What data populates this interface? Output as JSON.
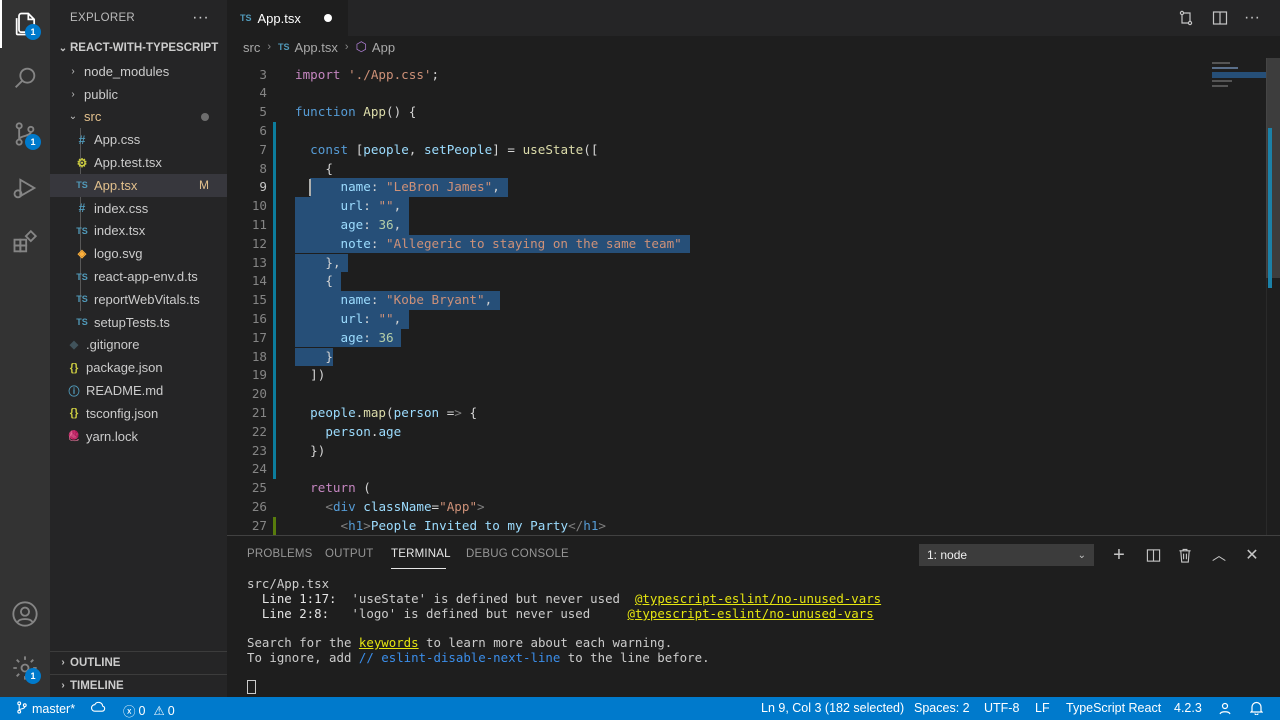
{
  "activity": {
    "explorer_badge": "1",
    "scm_badge": "1",
    "settings_badge": "1"
  },
  "sidebar": {
    "header": "EXPLORER",
    "more": "···",
    "project": "REACT-WITH-TYPESCRIPT",
    "items": [
      {
        "label": "node_modules",
        "icon": "chevron-right",
        "kind": "folder"
      },
      {
        "label": "public",
        "icon": "chevron-right",
        "kind": "folder"
      },
      {
        "label": "src",
        "icon": "chevron-down",
        "kind": "folder-open"
      },
      {
        "label": "App.css",
        "icon": "#",
        "kind": "css"
      },
      {
        "label": "App.test.tsx",
        "icon": "test",
        "kind": "test"
      },
      {
        "label": "App.tsx",
        "icon": "TS",
        "kind": "ts",
        "status": "M"
      },
      {
        "label": "index.css",
        "icon": "#",
        "kind": "css"
      },
      {
        "label": "index.tsx",
        "icon": "TS",
        "kind": "ts"
      },
      {
        "label": "logo.svg",
        "icon": "svg",
        "kind": "svg"
      },
      {
        "label": "react-app-env.d.ts",
        "icon": "TS",
        "kind": "ts"
      },
      {
        "label": "reportWebVitals.ts",
        "icon": "TS",
        "kind": "ts"
      },
      {
        "label": "setupTests.ts",
        "icon": "TS",
        "kind": "ts"
      },
      {
        "label": ".gitignore",
        "icon": "git",
        "kind": "git"
      },
      {
        "label": "package.json",
        "icon": "{}",
        "kind": "json"
      },
      {
        "label": "README.md",
        "icon": "info",
        "kind": "info"
      },
      {
        "label": "tsconfig.json",
        "icon": "{}",
        "kind": "json"
      },
      {
        "label": "yarn.lock",
        "icon": "yarn",
        "kind": "yarn"
      }
    ],
    "outline": "OUTLINE",
    "timeline": "TIMELINE"
  },
  "tab": {
    "lang": "TS",
    "name": "App.tsx"
  },
  "breadcrumb": {
    "folder": "src",
    "lang": "TS",
    "file": "App.tsx",
    "symbol": "App"
  },
  "editor": {
    "lines": [
      {
        "n": "3",
        "code": "import './App.css';"
      },
      {
        "n": "4",
        "code": ""
      },
      {
        "n": "5",
        "code": "function App() {"
      },
      {
        "n": "6",
        "code": ""
      },
      {
        "n": "7",
        "code": "  const [people, setPeople] = useState(["
      },
      {
        "n": "8",
        "code": "    {"
      },
      {
        "n": "9",
        "code": "      name: \"LeBron James\","
      },
      {
        "n": "10",
        "code": "      url: \"\","
      },
      {
        "n": "11",
        "code": "      age: 36,"
      },
      {
        "n": "12",
        "code": "      note: \"Allegeric to staying on the same team\""
      },
      {
        "n": "13",
        "code": "    },"
      },
      {
        "n": "14",
        "code": "    {"
      },
      {
        "n": "15",
        "code": "      name: \"Kobe Bryant\","
      },
      {
        "n": "16",
        "code": "      url: \"\","
      },
      {
        "n": "17",
        "code": "      age: 36"
      },
      {
        "n": "18",
        "code": "    }"
      },
      {
        "n": "19",
        "code": "  ])"
      },
      {
        "n": "20",
        "code": ""
      },
      {
        "n": "21",
        "code": "  people.map(person => {"
      },
      {
        "n": "22",
        "code": "    person.age"
      },
      {
        "n": "23",
        "code": "  })"
      },
      {
        "n": "24",
        "code": ""
      },
      {
        "n": "25",
        "code": "  return ("
      },
      {
        "n": "26",
        "code": "    <div className=\"App\">"
      },
      {
        "n": "27",
        "code": "      <h1>People Invited to my Party</h1>"
      }
    ]
  },
  "panel": {
    "tabs": [
      "PROBLEMS",
      "OUTPUT",
      "TERMINAL",
      "DEBUG CONSOLE"
    ],
    "active_tab": "TERMINAL",
    "terminal_select": "1: node",
    "terminal": {
      "file": "src/App.tsx",
      "w1_loc": "Line 1:17:",
      "w1_msg": "'useState' is defined but never used",
      "w1_rule": "@typescript-eslint/no-unused-vars",
      "w2_loc": "Line 2:8:",
      "w2_msg": "'logo' is defined but never used",
      "w2_rule": "@typescript-eslint/no-unused-vars",
      "search_pre": "Search for the ",
      "search_kw": "keywords",
      "search_post": " to learn more about each warning.",
      "ignore_pre": "To ignore, add ",
      "ignore_kw": "// eslint-disable-next-line",
      "ignore_post": " to the line before."
    }
  },
  "status": {
    "branch": "master*",
    "errors": "0",
    "warnings": "0",
    "position": "Ln 9, Col 3 (182 selected)",
    "spaces": "Spaces: 2",
    "encoding": "UTF-8",
    "eol": "LF",
    "language": "TypeScript React",
    "version": "4.2.3"
  },
  "colors": {
    "accent": "#007acc",
    "selection": "#264f78",
    "modified": "#e2c08d"
  }
}
